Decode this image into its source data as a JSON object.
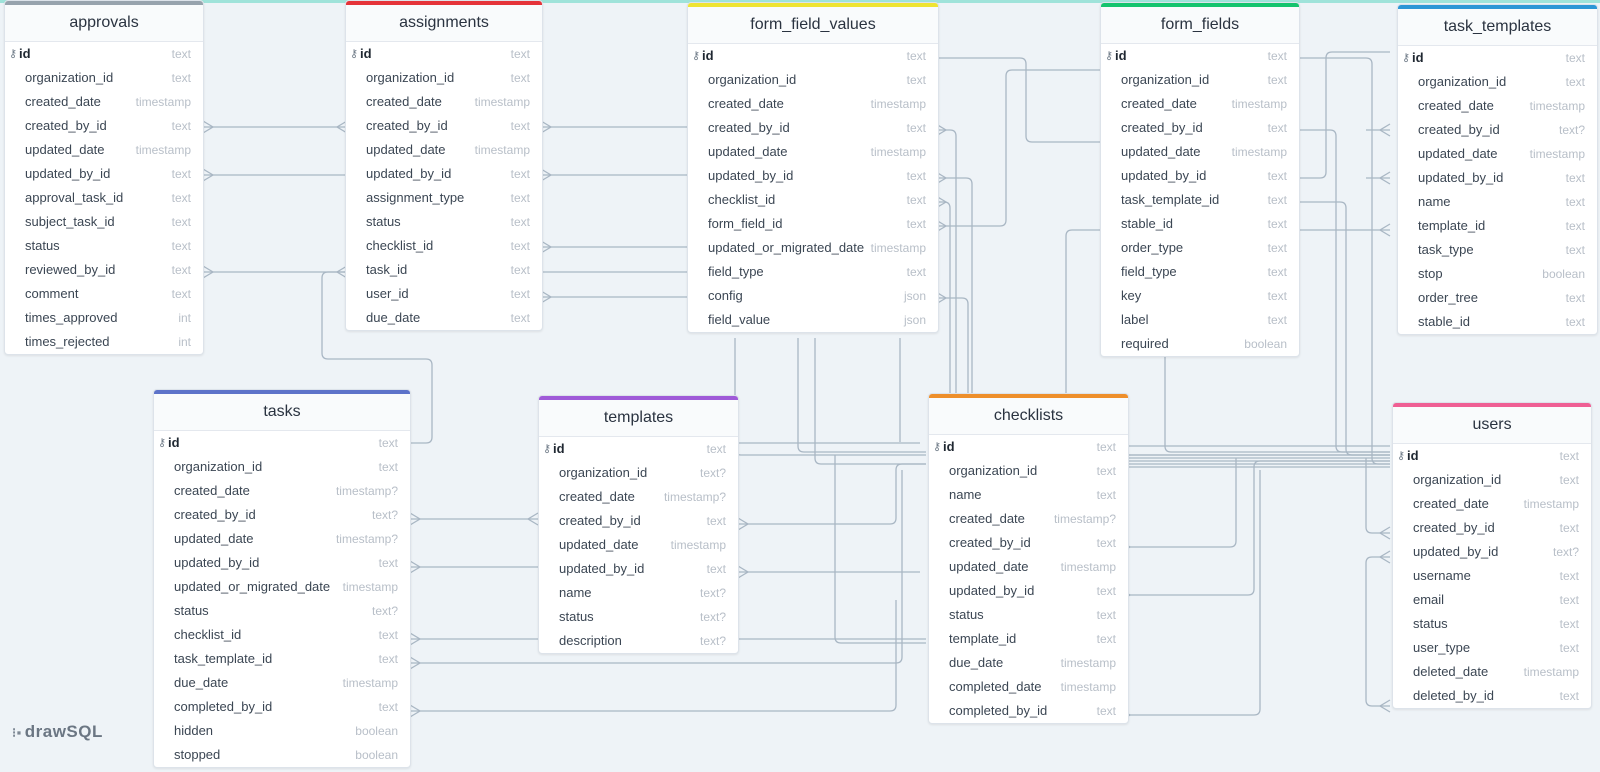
{
  "colors": {
    "approvals": "#97a3ad",
    "assignments": "#e53339",
    "form_field_values": "#efe432",
    "form_fields": "#14c46e",
    "task_templates": "#2c96d6",
    "tasks": "#5d73c9",
    "templates": "#9f5ad8",
    "checklists": "#ee8f2b",
    "users": "#ef5f94"
  },
  "logo": {
    "text": "drawSQL",
    "icon": "drawsql-logo-icon"
  },
  "tables": {
    "approvals": {
      "name": "approvals",
      "fields": [
        {
          "name": "id",
          "type": "text",
          "pk": true
        },
        {
          "name": "organization_id",
          "type": "text"
        },
        {
          "name": "created_date",
          "type": "timestamp"
        },
        {
          "name": "created_by_id",
          "type": "text"
        },
        {
          "name": "updated_date",
          "type": "timestamp"
        },
        {
          "name": "updated_by_id",
          "type": "text"
        },
        {
          "name": "approval_task_id",
          "type": "text"
        },
        {
          "name": "subject_task_id",
          "type": "text"
        },
        {
          "name": "status",
          "type": "text"
        },
        {
          "name": "reviewed_by_id",
          "type": "text"
        },
        {
          "name": "comment",
          "type": "text"
        },
        {
          "name": "times_approved",
          "type": "int"
        },
        {
          "name": "times_rejected",
          "type": "int"
        }
      ]
    },
    "assignments": {
      "name": "assignments",
      "fields": [
        {
          "name": "id",
          "type": "text",
          "pk": true
        },
        {
          "name": "organization_id",
          "type": "text"
        },
        {
          "name": "created_date",
          "type": "timestamp"
        },
        {
          "name": "created_by_id",
          "type": "text"
        },
        {
          "name": "updated_date",
          "type": "timestamp"
        },
        {
          "name": "updated_by_id",
          "type": "text"
        },
        {
          "name": "assignment_type",
          "type": "text"
        },
        {
          "name": "status",
          "type": "text"
        },
        {
          "name": "checklist_id",
          "type": "text"
        },
        {
          "name": "task_id",
          "type": "text"
        },
        {
          "name": "user_id",
          "type": "text"
        },
        {
          "name": "due_date",
          "type": "text"
        }
      ]
    },
    "form_field_values": {
      "name": "form_field_values",
      "fields": [
        {
          "name": "id",
          "type": "text",
          "pk": true
        },
        {
          "name": "organization_id",
          "type": "text"
        },
        {
          "name": "created_date",
          "type": "timestamp"
        },
        {
          "name": "created_by_id",
          "type": "text"
        },
        {
          "name": "updated_date",
          "type": "timestamp"
        },
        {
          "name": "updated_by_id",
          "type": "text"
        },
        {
          "name": "checklist_id",
          "type": "text"
        },
        {
          "name": "form_field_id",
          "type": "text"
        },
        {
          "name": "updated_or_migrated_date",
          "type": "timestamp"
        },
        {
          "name": "field_type",
          "type": "text"
        },
        {
          "name": "config",
          "type": "json"
        },
        {
          "name": "field_value",
          "type": "json"
        }
      ]
    },
    "form_fields": {
      "name": "form_fields",
      "fields": [
        {
          "name": "id",
          "type": "text",
          "pk": true
        },
        {
          "name": "organization_id",
          "type": "text"
        },
        {
          "name": "created_date",
          "type": "timestamp"
        },
        {
          "name": "created_by_id",
          "type": "text"
        },
        {
          "name": "updated_date",
          "type": "timestamp"
        },
        {
          "name": "updated_by_id",
          "type": "text"
        },
        {
          "name": "task_template_id",
          "type": "text"
        },
        {
          "name": "stable_id",
          "type": "text"
        },
        {
          "name": "order_type",
          "type": "text"
        },
        {
          "name": "field_type",
          "type": "text"
        },
        {
          "name": "key",
          "type": "text"
        },
        {
          "name": "label",
          "type": "text"
        },
        {
          "name": "required",
          "type": "boolean"
        }
      ]
    },
    "task_templates": {
      "name": "task_templates",
      "fields": [
        {
          "name": "id",
          "type": "text",
          "pk": true
        },
        {
          "name": "organization_id",
          "type": "text"
        },
        {
          "name": "created_date",
          "type": "timestamp"
        },
        {
          "name": "created_by_id",
          "type": "text?"
        },
        {
          "name": "updated_date",
          "type": "timestamp"
        },
        {
          "name": "updated_by_id",
          "type": "text"
        },
        {
          "name": "name",
          "type": "text"
        },
        {
          "name": "template_id",
          "type": "text"
        },
        {
          "name": "task_type",
          "type": "text"
        },
        {
          "name": "stop",
          "type": "boolean"
        },
        {
          "name": "order_tree",
          "type": "text"
        },
        {
          "name": "stable_id",
          "type": "text"
        }
      ]
    },
    "tasks": {
      "name": "tasks",
      "fields": [
        {
          "name": "id",
          "type": "text",
          "pk": true
        },
        {
          "name": "organization_id",
          "type": "text"
        },
        {
          "name": "created_date",
          "type": "timestamp?"
        },
        {
          "name": "created_by_id",
          "type": "text?"
        },
        {
          "name": "updated_date",
          "type": "timestamp?"
        },
        {
          "name": "updated_by_id",
          "type": "text"
        },
        {
          "name": "updated_or_migrated_date",
          "type": "timestamp"
        },
        {
          "name": "status",
          "type": "text?"
        },
        {
          "name": "checklist_id",
          "type": "text"
        },
        {
          "name": "task_template_id",
          "type": "text"
        },
        {
          "name": "due_date",
          "type": "timestamp"
        },
        {
          "name": "completed_by_id",
          "type": "text"
        },
        {
          "name": "hidden",
          "type": "boolean"
        },
        {
          "name": "stopped",
          "type": "boolean"
        }
      ]
    },
    "templates": {
      "name": "templates",
      "fields": [
        {
          "name": "id",
          "type": "text",
          "pk": true
        },
        {
          "name": "organization_id",
          "type": "text?"
        },
        {
          "name": "created_date",
          "type": "timestamp?"
        },
        {
          "name": "created_by_id",
          "type": "text"
        },
        {
          "name": "updated_date",
          "type": "timestamp"
        },
        {
          "name": "updated_by_id",
          "type": "text"
        },
        {
          "name": "name",
          "type": "text?"
        },
        {
          "name": "status",
          "type": "text?"
        },
        {
          "name": "description",
          "type": "text?"
        }
      ]
    },
    "checklists": {
      "name": "checklists",
      "fields": [
        {
          "name": "id",
          "type": "text",
          "pk": true
        },
        {
          "name": "organization_id",
          "type": "text"
        },
        {
          "name": "name",
          "type": "text"
        },
        {
          "name": "created_date",
          "type": "timestamp?"
        },
        {
          "name": "created_by_id",
          "type": "text"
        },
        {
          "name": "updated_date",
          "type": "timestamp"
        },
        {
          "name": "updated_by_id",
          "type": "text"
        },
        {
          "name": "status",
          "type": "text"
        },
        {
          "name": "template_id",
          "type": "text"
        },
        {
          "name": "due_date",
          "type": "timestamp"
        },
        {
          "name": "completed_date",
          "type": "timestamp"
        },
        {
          "name": "completed_by_id",
          "type": "text"
        }
      ]
    },
    "users": {
      "name": "users",
      "fields": [
        {
          "name": "id",
          "type": "text",
          "pk": true
        },
        {
          "name": "organization_id",
          "type": "text"
        },
        {
          "name": "created_date",
          "type": "timestamp"
        },
        {
          "name": "created_by_id",
          "type": "text"
        },
        {
          "name": "updated_by_id",
          "type": "text?"
        },
        {
          "name": "username",
          "type": "text"
        },
        {
          "name": "email",
          "type": "text"
        },
        {
          "name": "status",
          "type": "text"
        },
        {
          "name": "user_type",
          "type": "text"
        },
        {
          "name": "deleted_date",
          "type": "timestamp"
        },
        {
          "name": "deleted_by_id",
          "type": "text"
        }
      ]
    }
  }
}
